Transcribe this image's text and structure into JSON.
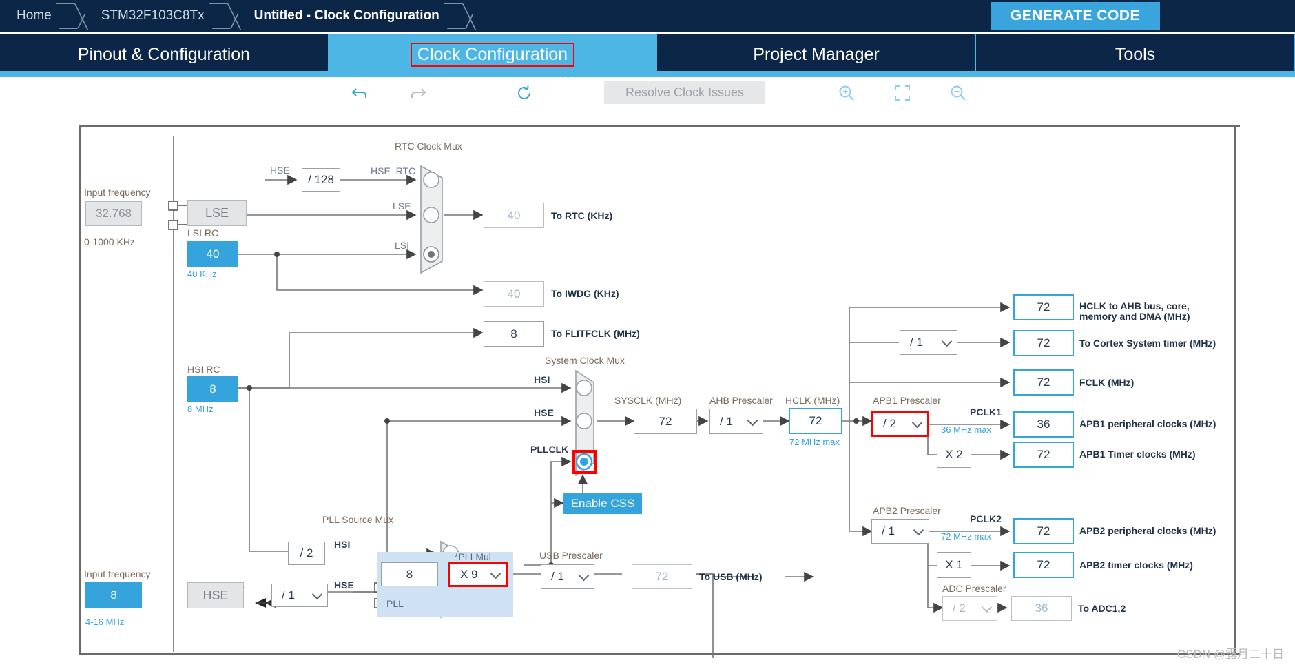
{
  "breadcrumb": {
    "items": [
      {
        "label": "Home",
        "active": false
      },
      {
        "label": "STM32F103C8Tx",
        "active": false
      },
      {
        "label": "Untitled - Clock Configuration",
        "active": true
      }
    ],
    "generate_code_label": "GENERATE CODE"
  },
  "tabs": [
    {
      "label": "Pinout & Configuration",
      "selected": false
    },
    {
      "label": "Clock Configuration",
      "selected": true
    },
    {
      "label": "Project Manager",
      "selected": false
    },
    {
      "label": "Tools",
      "selected": false
    }
  ],
  "toolbar": {
    "undo": "undo-icon",
    "redo": "redo-icon",
    "reset": "reset-icon",
    "resolve_label": "Resolve Clock Issues",
    "zoom_in": "zoom-in-icon",
    "fit": "fit-to-screen-icon",
    "zoom_out": "zoom-out-icon"
  },
  "colors": {
    "accent": "#35a3dc",
    "navy": "#0b2646",
    "highlight_red": "#ff0000",
    "pll_panel": "#cfe2f3"
  },
  "diagram": {
    "lse": {
      "input_frequency_label": "Input frequency",
      "input_frequency_value": "32.768",
      "range": "0-1000 KHz",
      "name": "LSE"
    },
    "lsi": {
      "title": "LSI RC",
      "value": "40",
      "unit": "40 KHz"
    },
    "hse_div": {
      "value": "/ 128"
    },
    "rtc_mux": {
      "title": "RTC Clock Mux",
      "inputs": [
        {
          "label": "HSE_RTC",
          "selected": false
        },
        {
          "label": "LSE",
          "selected": false
        },
        {
          "label": "LSI",
          "selected": true
        }
      ]
    },
    "hse_signal_label": "HSE",
    "to_rtc": {
      "value": "40",
      "label": "To RTC (KHz)"
    },
    "to_iwdg": {
      "value": "40",
      "label": "To IWDG (KHz)"
    },
    "to_flitfclk": {
      "value": "8",
      "label": "To FLITFCLK (MHz)"
    },
    "hsi": {
      "title": "HSI RC",
      "value": "8",
      "unit": "8 MHz"
    },
    "hse": {
      "input_frequency_label": "Input frequency",
      "input_frequency_value": "8",
      "range": "4-16 MHz",
      "name": "HSE"
    },
    "sys_clock_mux": {
      "title": "System Clock Mux",
      "inputs": [
        {
          "label": "HSI",
          "selected": false
        },
        {
          "label": "HSE",
          "selected": false
        },
        {
          "label": "PLLCLK",
          "selected": true
        }
      ]
    },
    "enable_css_label": "Enable CSS",
    "sysclk": {
      "title": "SYSCLK (MHz)",
      "value": "72"
    },
    "ahb_prescaler": {
      "title": "AHB Prescaler",
      "value": "/ 1"
    },
    "hclk": {
      "title": "HCLK (MHz)",
      "value": "72",
      "max": "72 MHz max"
    },
    "pll_source_mux": {
      "title": "PLL Source Mux",
      "inputs": [
        {
          "label": "HSI",
          "selected": false
        },
        {
          "label": "HSE",
          "selected": true
        }
      ],
      "hsi_div": "/ 2",
      "hse_div": "/ 1"
    },
    "pll": {
      "panel_label": "PLL",
      "input_value": "8",
      "pllmul_label": "*PLLMul",
      "pllmul_value": "X 9"
    },
    "usb_prescaler": {
      "title": "USB Prescaler",
      "value": "/ 1"
    },
    "to_usb": {
      "value": "72",
      "label": "To USB (MHz)"
    },
    "outputs": {
      "hclk_ahb": {
        "value": "72",
        "label_line1": "HCLK to AHB bus, core,",
        "label_line2": "memory and DMA (MHz)"
      },
      "cortex_timer": {
        "value": "72",
        "label": "To Cortex System timer (MHz)",
        "prescaler": "/ 1"
      },
      "fclk": {
        "value": "72",
        "label": "FCLK (MHz)"
      }
    },
    "apb1": {
      "prescaler_title": "APB1 Prescaler",
      "prescaler_value": "/ 2",
      "pclk_label": "PCLK1",
      "max": "36 MHz max",
      "periph": {
        "value": "36",
        "label": "APB1 peripheral clocks (MHz)"
      },
      "timer_mult": "X 2",
      "timer": {
        "value": "72",
        "label": "APB1 Timer clocks (MHz)"
      }
    },
    "apb2": {
      "prescaler_title": "APB2 Prescaler",
      "prescaler_value": "/ 1",
      "pclk_label": "PCLK2",
      "max": "72 MHz max",
      "periph": {
        "value": "72",
        "label": "APB2 peripheral clocks (MHz)"
      },
      "timer_mult": "X 1",
      "timer": {
        "value": "72",
        "label": "APB2 timer clocks (MHz)"
      },
      "adc_prescaler_title": "ADC Prescaler",
      "adc_prescaler_value": "/ 2",
      "adc": {
        "value": "36",
        "label": "To ADC1,2"
      }
    }
  },
  "watermark": "CSDN @露月二十日"
}
